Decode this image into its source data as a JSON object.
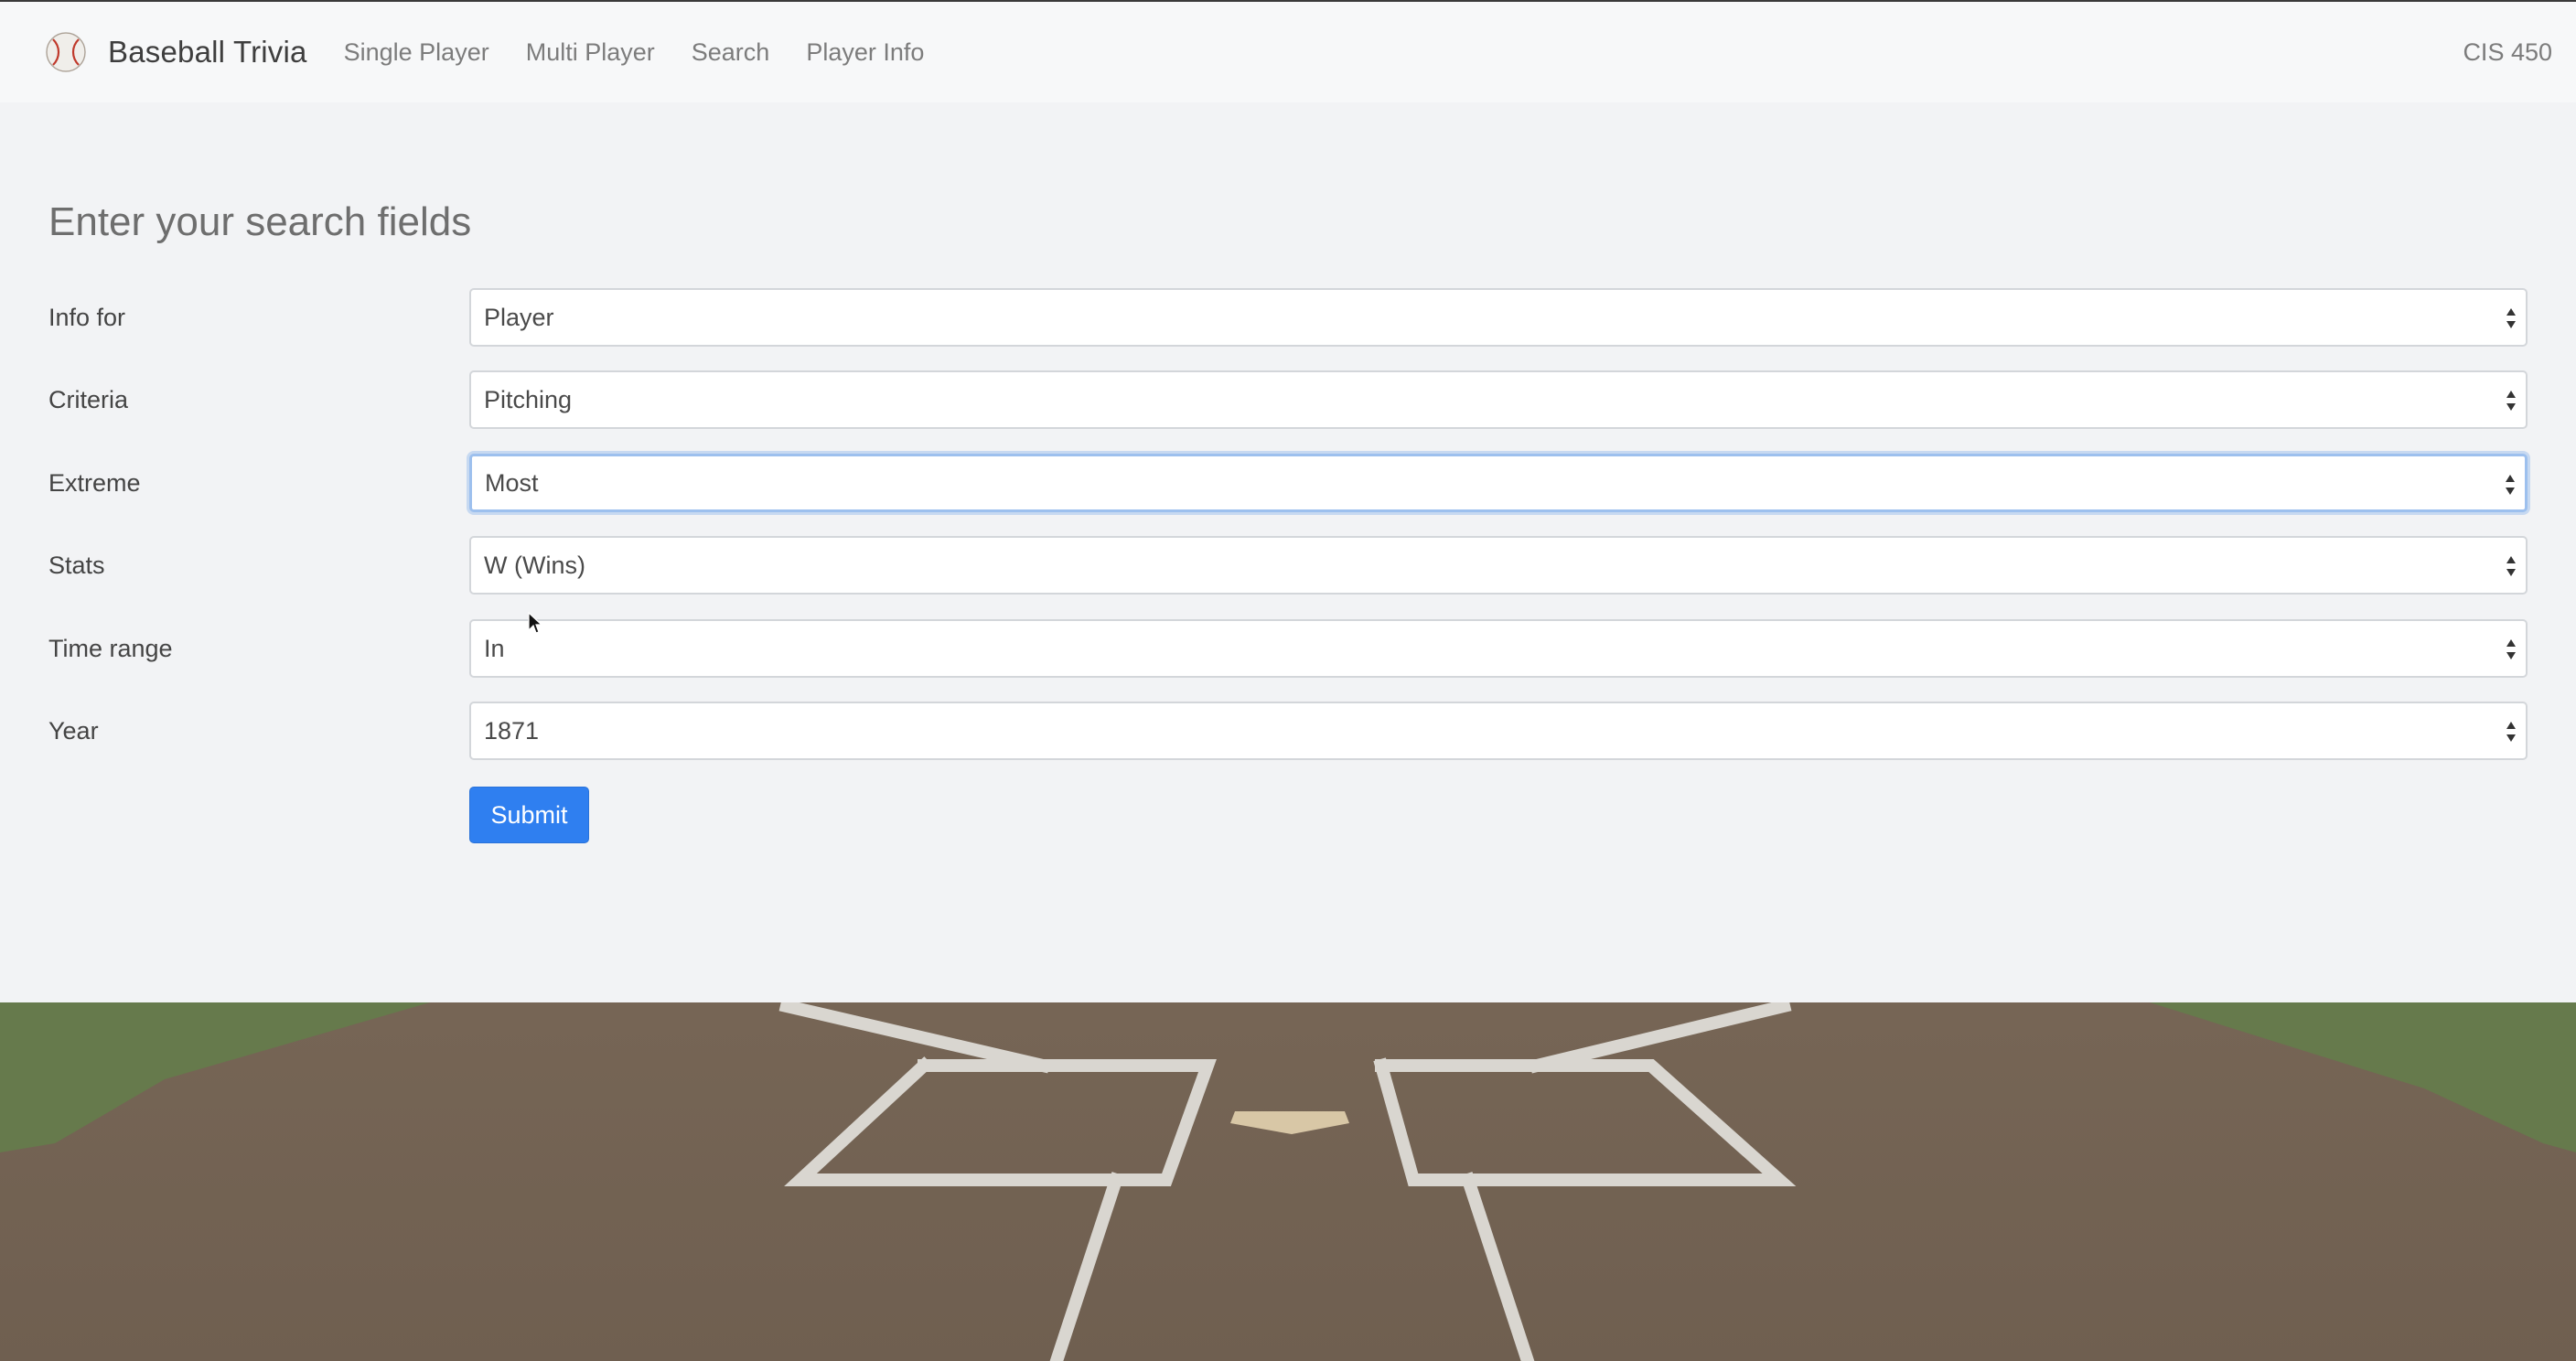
{
  "navbar": {
    "brand": "Baseball Trivia",
    "links": [
      "Single Player",
      "Multi Player",
      "Search",
      "Player Info"
    ],
    "right_label": "CIS 450"
  },
  "form": {
    "title": "Enter your search fields",
    "fields": [
      {
        "label": "Info for",
        "value": "Player"
      },
      {
        "label": "Criteria",
        "value": "Pitching"
      },
      {
        "label": "Extreme",
        "value": "Most"
      },
      {
        "label": "Stats",
        "value": "W (Wins)"
      },
      {
        "label": "Time range",
        "value": "In"
      },
      {
        "label": "Year",
        "value": "1871"
      }
    ],
    "focused_field": "Extreme",
    "submit_label": "Submit"
  },
  "icons": {
    "brand": "baseball-icon",
    "select_caret": "updown-caret-icon",
    "pointer": "mouse-pointer-icon"
  },
  "colors": {
    "primary": "#2f7ff0",
    "navbar_bg": "#f7f8f9",
    "panel_bg": "#f2f3f5",
    "focus_ring": "#9dc0ee"
  }
}
